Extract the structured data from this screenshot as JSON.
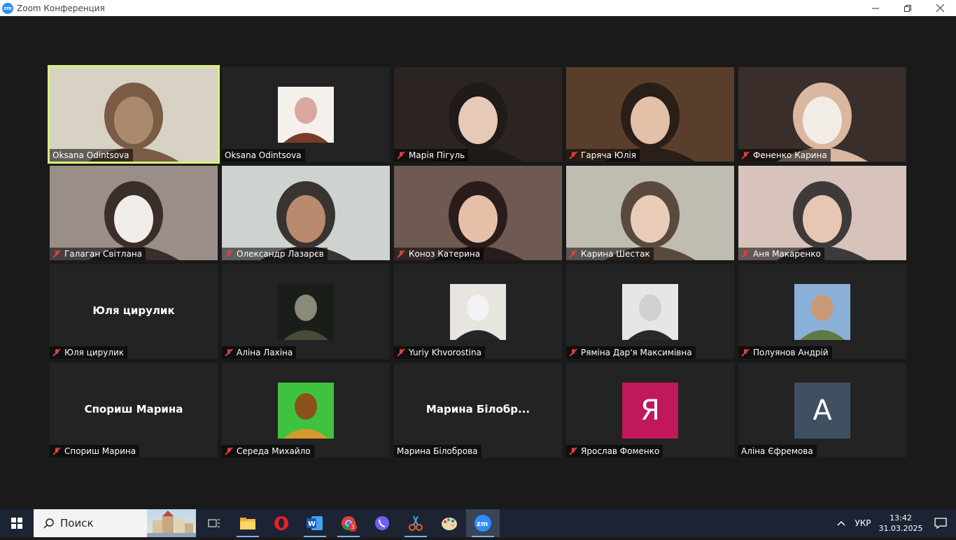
{
  "window": {
    "title": "Zoom Конференция",
    "app_icon": "zm"
  },
  "participants": [
    {
      "name": "Oksana Odintsova",
      "muted": false,
      "active": true,
      "kind": "video"
    },
    {
      "name": "Oksana Odintsova",
      "muted": false,
      "kind": "photo"
    },
    {
      "name": "Марія Пігуль",
      "muted": true,
      "kind": "video"
    },
    {
      "name": "Гаряча Юлія",
      "muted": true,
      "kind": "video"
    },
    {
      "name": "Фененко Карина",
      "muted": true,
      "kind": "video"
    },
    {
      "name": "Галаган Світлана",
      "muted": true,
      "kind": "video"
    },
    {
      "name": "Олександр Лазарєв",
      "muted": true,
      "kind": "video"
    },
    {
      "name": "Коноз Катерина",
      "muted": true,
      "kind": "video"
    },
    {
      "name": "Карина Шестак",
      "muted": true,
      "kind": "video"
    },
    {
      "name": "Аня Макаренко",
      "muted": true,
      "kind": "video"
    },
    {
      "name": "Юля цирулик",
      "muted": true,
      "kind": "name",
      "display": "Юля цирулик"
    },
    {
      "name": "Аліна Лахіна",
      "muted": true,
      "kind": "photo"
    },
    {
      "name": "Yuriy Khvorostina",
      "muted": true,
      "kind": "photo"
    },
    {
      "name": "Ряміна Дар'я Максимівна",
      "muted": true,
      "kind": "photo"
    },
    {
      "name": "Полуянов Андрій",
      "muted": true,
      "kind": "photo"
    },
    {
      "name": "Спориш Марина",
      "muted": true,
      "kind": "name",
      "display": "Спориш Марина"
    },
    {
      "name": "Середа Михайло",
      "muted": true,
      "kind": "photo"
    },
    {
      "name": "Марина Білоброва",
      "muted": false,
      "kind": "name",
      "display": "Марина  Білобр..."
    },
    {
      "name": "Ярослав Фоменко",
      "muted": true,
      "kind": "letter",
      "letter": "Я",
      "color": "#c0185a"
    },
    {
      "name": "Аліна Єфремова",
      "muted": false,
      "kind": "letter",
      "letter": "A",
      "color": "#3f5060"
    }
  ],
  "taskbar": {
    "search_placeholder": "Поиск",
    "language": "УКР",
    "time": "13:42",
    "date": "31.03.2025",
    "chrome_badge": "3"
  },
  "colors": {
    "active_speaker": "#d9f27a",
    "muted": "#e0403a",
    "zoom_blue": "#2d8cff"
  }
}
